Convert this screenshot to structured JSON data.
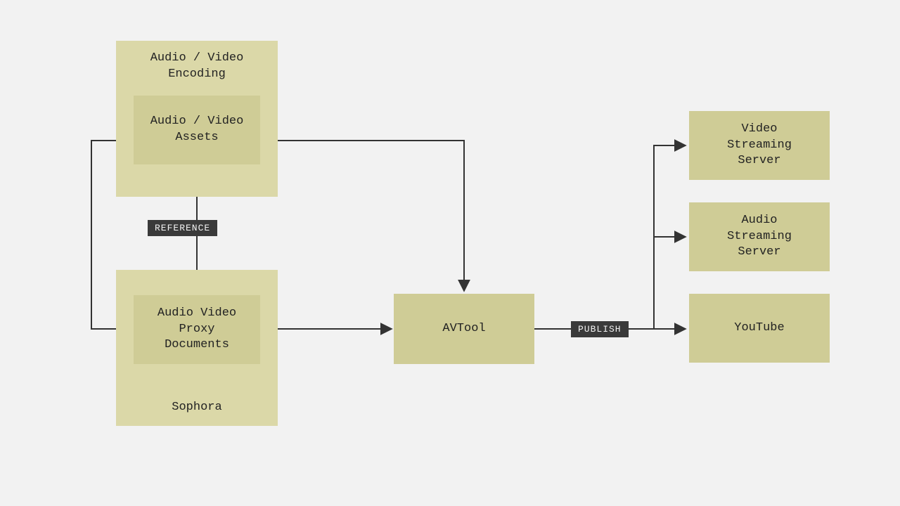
{
  "diagram": {
    "containers": {
      "encoding": {
        "title": "Audio / Video\nEncoding"
      },
      "sophora": {
        "title": "Sophora"
      }
    },
    "nodes": {
      "assets": {
        "label": "Audio / Video\nAssets"
      },
      "proxy": {
        "label": "Audio Video\nProxy\nDocuments"
      },
      "avtool": {
        "label": "AVTool"
      },
      "vss": {
        "label": "Video\nStreaming\nServer"
      },
      "ass": {
        "label": "Audio\nStreaming\nServer"
      },
      "youtube": {
        "label": "YouTube"
      }
    },
    "edges": {
      "reference": {
        "label": "REFERENCE"
      },
      "publish": {
        "label": "PUBLISH"
      }
    }
  }
}
